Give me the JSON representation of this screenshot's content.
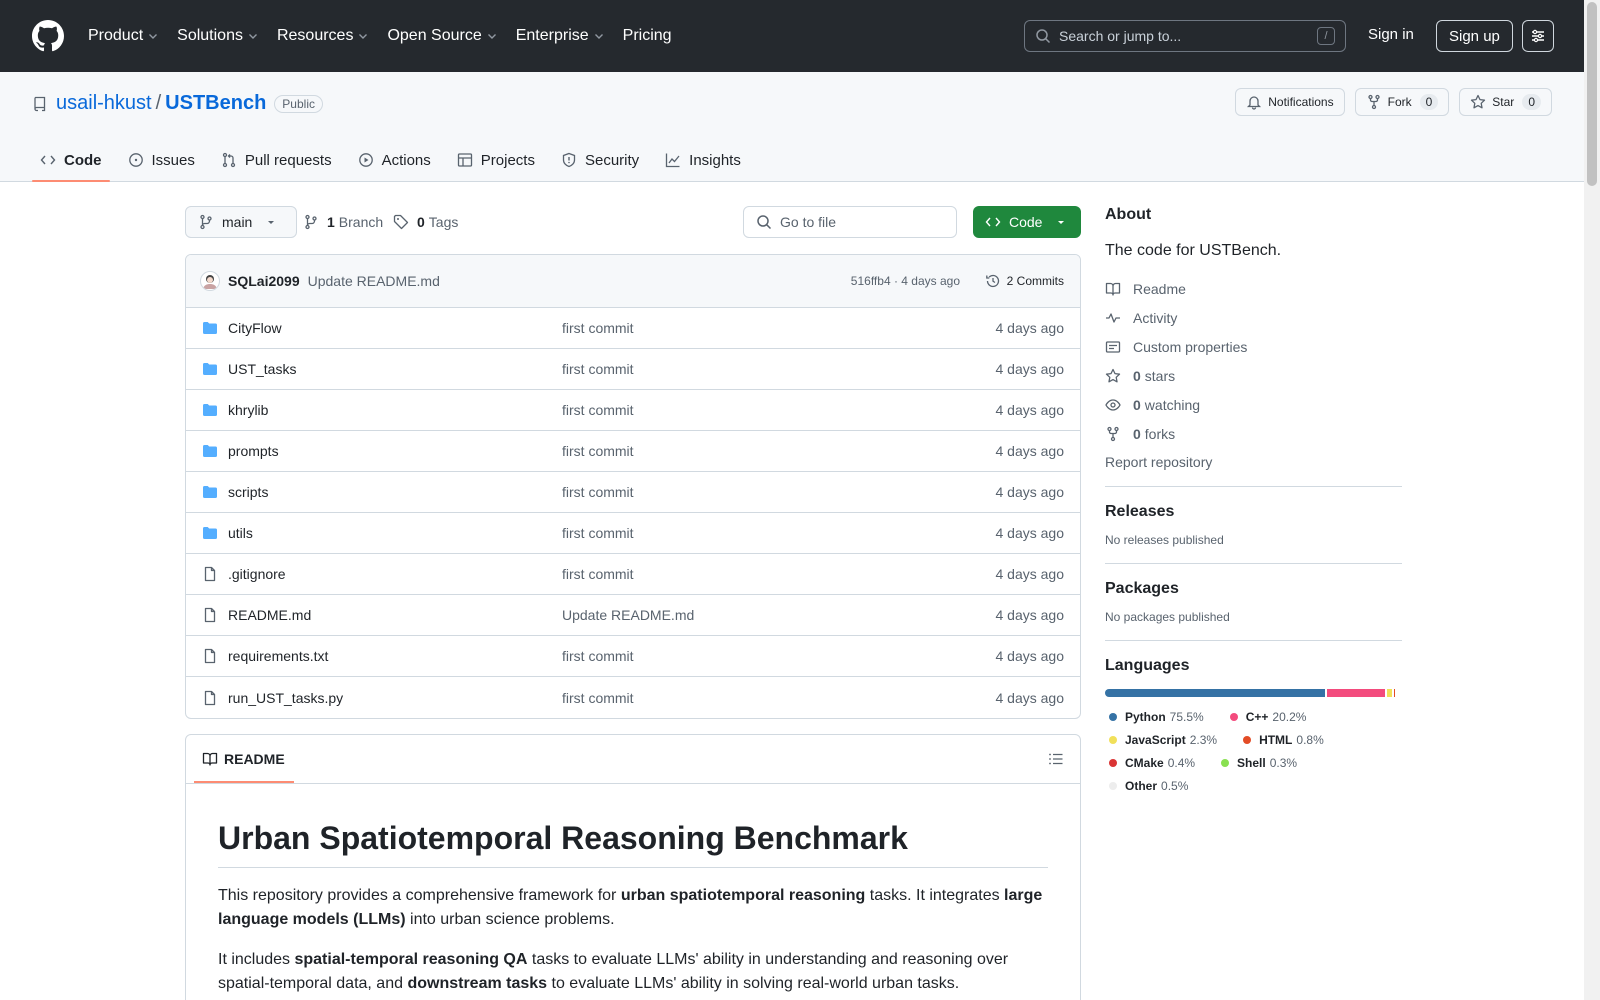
{
  "header": {
    "nav": [
      "Product",
      "Solutions",
      "Resources",
      "Open Source",
      "Enterprise",
      "Pricing"
    ],
    "search_placeholder": "Search or jump to...",
    "search_shortcut": "/",
    "signin": "Sign in",
    "signup": "Sign up"
  },
  "repo": {
    "owner": "usail-hkust",
    "separator": "/",
    "name": "USTBench",
    "visibility": "Public",
    "notifications": "Notifications",
    "fork_label": "Fork",
    "fork_count": "0",
    "star_label": "Star",
    "star_count": "0",
    "tabs": [
      "Code",
      "Issues",
      "Pull requests",
      "Actions",
      "Projects",
      "Security",
      "Insights"
    ]
  },
  "toolbar": {
    "branch": "main",
    "branch_count": "1",
    "branch_label": "Branch",
    "tag_count": "0",
    "tag_label": "Tags",
    "goto_placeholder": "Go to file",
    "code_label": "Code"
  },
  "commit": {
    "author": "SQLai2099",
    "message": "Update README.md",
    "meta": "516ffb4 · 4 days ago",
    "commits": "2 Commits"
  },
  "files": [
    {
      "name": "CityFlow",
      "type": "dir",
      "message": "first commit",
      "time": "4 days ago"
    },
    {
      "name": "UST_tasks",
      "type": "dir",
      "message": "first commit",
      "time": "4 days ago"
    },
    {
      "name": "khrylib",
      "type": "dir",
      "message": "first commit",
      "time": "4 days ago"
    },
    {
      "name": "prompts",
      "type": "dir",
      "message": "first commit",
      "time": "4 days ago"
    },
    {
      "name": "scripts",
      "type": "dir",
      "message": "first commit",
      "time": "4 days ago"
    },
    {
      "name": "utils",
      "type": "dir",
      "message": "first commit",
      "time": "4 days ago"
    },
    {
      "name": ".gitignore",
      "type": "file",
      "message": "first commit",
      "time": "4 days ago"
    },
    {
      "name": "README.md",
      "type": "file",
      "message": "Update README.md",
      "time": "4 days ago"
    },
    {
      "name": "requirements.txt",
      "type": "file",
      "message": "first commit",
      "time": "4 days ago"
    },
    {
      "name": "run_UST_tasks.py",
      "type": "file",
      "message": "first commit",
      "time": "4 days ago"
    }
  ],
  "readme": {
    "tab": "README",
    "title": "Urban Spatiotemporal Reasoning Benchmark",
    "p1": [
      {
        "t": "This repository provides a comprehensive framework for ",
        "b": false
      },
      {
        "t": "urban spatiotemporal reasoning",
        "b": true
      },
      {
        "t": " tasks. It integrates ",
        "b": false
      },
      {
        "t": "large language models (LLMs)",
        "b": true
      },
      {
        "t": " into urban science problems.",
        "b": false
      }
    ],
    "p2": [
      {
        "t": "It includes ",
        "b": false
      },
      {
        "t": "spatial-temporal reasoning QA",
        "b": true
      },
      {
        "t": " tasks to evaluate LLMs' ability in understanding and reasoning over spatial-temporal data, and ",
        "b": false
      },
      {
        "t": "downstream tasks",
        "b": true
      },
      {
        "t": " to evaluate LLMs' ability in solving real-world urban tasks.",
        "b": false
      }
    ]
  },
  "about": {
    "title": "About",
    "description": "The code for USTBench.",
    "readme": "Readme",
    "activity": "Activity",
    "custom": "Custom properties",
    "stars_count": "0",
    "stars_label": "stars",
    "watching_count": "0",
    "watching_label": "watching",
    "forks_count": "0",
    "forks_label": "forks",
    "report": "Report repository"
  },
  "releases": {
    "title": "Releases",
    "none": "No releases published"
  },
  "packages": {
    "title": "Packages",
    "none": "No packages published"
  },
  "languages": {
    "title": "Languages",
    "items": [
      {
        "name": "Python",
        "pct": "75.5%",
        "value": 75.5,
        "color": "#3572A5"
      },
      {
        "name": "C++",
        "pct": "20.2%",
        "value": 20.2,
        "color": "#f34b7d"
      },
      {
        "name": "JavaScript",
        "pct": "2.3%",
        "value": 2.3,
        "color": "#f1e05a"
      },
      {
        "name": "HTML",
        "pct": "0.8%",
        "value": 0.8,
        "color": "#e34c26"
      },
      {
        "name": "CMake",
        "pct": "0.4%",
        "value": 0.4,
        "color": "#DA3434"
      },
      {
        "name": "Shell",
        "pct": "0.3%",
        "value": 0.3,
        "color": "#89e051"
      },
      {
        "name": "Other",
        "pct": "0.5%",
        "value": 0.5,
        "color": "#ededed"
      }
    ]
  }
}
